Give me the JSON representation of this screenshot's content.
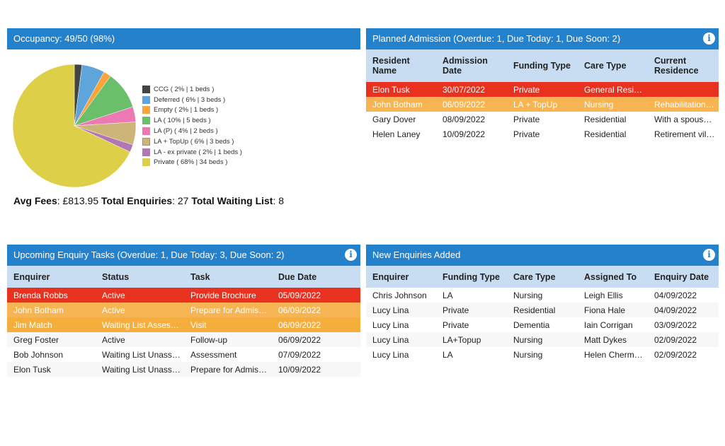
{
  "occupancy": {
    "title": "Occupancy: 49/50 (98%)",
    "stats": {
      "avg_fees_label": "Avg Fees",
      "avg_fees_value": ": £813.95 ",
      "total_enquiries_label": "Total Enquiries",
      "total_enquiries_value": ": 27 ",
      "total_waiting_label": "Total Waiting List",
      "total_waiting_value": ": 8"
    }
  },
  "chart_data": {
    "type": "pie",
    "title": "Occupancy: 49/50 (98%)",
    "legend_position": "right",
    "slices": [
      {
        "label": "CCG ( 2% | 1 beds )",
        "name": "CCG",
        "percent": 2,
        "beds": 1,
        "color": "#444444"
      },
      {
        "label": "Deferred ( 6% | 3 beds )",
        "name": "Deferred",
        "percent": 6,
        "beds": 3,
        "color": "#5da5da"
      },
      {
        "label": "Empty ( 2% | 1 beds )",
        "name": "Empty",
        "percent": 2,
        "beds": 1,
        "color": "#faa43a"
      },
      {
        "label": "LA ( 10% | 5 beds )",
        "name": "LA",
        "percent": 10,
        "beds": 5,
        "color": "#6abf6a"
      },
      {
        "label": "LA (P) ( 4% | 2 beds )",
        "name": "LA (P)",
        "percent": 4,
        "beds": 2,
        "color": "#ec79b4"
      },
      {
        "label": "LA + TopUp ( 6% | 3 beds )",
        "name": "LA + TopUp",
        "percent": 6,
        "beds": 3,
        "color": "#cdb577"
      },
      {
        "label": "LA - ex private ( 2% | 1 beds )",
        "name": "LA - ex private",
        "percent": 2,
        "beds": 1,
        "color": "#b276b2"
      },
      {
        "label": "Private ( 68% | 34 beds )",
        "name": "Private",
        "percent": 68,
        "beds": 34,
        "color": "#decf48"
      }
    ]
  },
  "planned": {
    "title": "Planned Admission (Overdue: 1, Due Today: 1, Due Soon: 2)",
    "headers": [
      "Resident Name",
      "Admission Date",
      "Funding Type",
      "Care Type",
      "Current Residence"
    ],
    "rows": [
      {
        "status": "overdue",
        "cells": [
          "Elon Tusk",
          "30/07/2022",
          "Private",
          "General Resi…",
          ""
        ]
      },
      {
        "status": "today",
        "cells": [
          "John Botham",
          "06/09/2022",
          "LA + TopUp",
          "Nursing",
          "Rehabilitation…"
        ]
      },
      {
        "status": "normal",
        "cells": [
          "Gary Dover",
          "08/09/2022",
          "Private",
          "Residential",
          "With a spous…"
        ]
      },
      {
        "status": "normal",
        "cells": [
          "Helen Laney",
          "10/09/2022",
          "Private",
          "Residential",
          "Retirement vil…"
        ]
      }
    ]
  },
  "tasks": {
    "title": "Upcoming Enquiry Tasks (Overdue: 1, Due Today: 3, Due Soon: 2)",
    "headers": [
      "Enquirer",
      "Status",
      "Task",
      "Due Date"
    ],
    "rows": [
      {
        "status": "overdue",
        "cells": [
          "Brenda Robbs",
          "Active",
          "Provide Brochure",
          "05/09/2022"
        ]
      },
      {
        "status": "today",
        "cells": [
          "John Botham",
          "Active",
          "Prepare for Admis…",
          "06/09/2022"
        ]
      },
      {
        "status": "today",
        "cells": [
          "Jim Match",
          "Waiting List Asses…",
          "Visit",
          "06/09/2022"
        ]
      },
      {
        "status": "normal",
        "cells": [
          "Greg Foster",
          "Active",
          "Follow-up",
          "06/09/2022"
        ]
      },
      {
        "status": "normal",
        "cells": [
          "Bob Johnson",
          "Waiting List Unass…",
          "Assessment",
          "07/09/2022"
        ]
      },
      {
        "status": "normal",
        "cells": [
          "Elon Tusk",
          "Waiting List Unass…",
          "Prepare for Admis…",
          "10/09/2022"
        ]
      }
    ]
  },
  "enquiries": {
    "title": "New Enquiries Added",
    "headers": [
      "Enquirer",
      "Funding Type",
      "Care Type",
      "Assigned To",
      "Enquiry Date"
    ],
    "rows": [
      {
        "cells": [
          "Chris Johnson",
          "LA",
          "Nursing",
          "Leigh Ellis",
          "04/09/2022"
        ]
      },
      {
        "cells": [
          "Lucy Lina",
          "Private",
          "Residential",
          "Fiona Hale",
          "04/09/2022"
        ]
      },
      {
        "cells": [
          "Lucy Lina",
          "Private",
          "Dementia",
          "Iain Corrigan",
          "03/09/2022"
        ]
      },
      {
        "cells": [
          "Lucy Lina",
          "LA+Topup",
          "Nursing",
          "Matt Dykes",
          "02/09/2022"
        ]
      },
      {
        "cells": [
          "Lucy Lina",
          "LA",
          "Nursing",
          "Helen Cherm…",
          "02/09/2022"
        ]
      }
    ]
  },
  "icons": {
    "info": "i"
  }
}
